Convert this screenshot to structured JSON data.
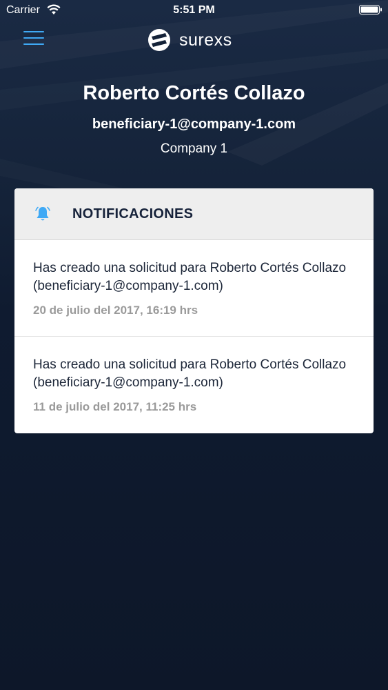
{
  "status_bar": {
    "carrier": "Carrier",
    "time": "5:51 PM"
  },
  "nav": {
    "menu_icon": "hamburger-menu-icon",
    "logo_text": "surexs"
  },
  "profile": {
    "name": "Roberto Cortés Collazo",
    "email": "beneficiary-1@company-1.com",
    "company": "Company 1"
  },
  "notifications": {
    "title": "NOTIFICACIONES",
    "icon": "bell-icon",
    "items": [
      {
        "text": "Has creado una solicitud para Roberto Cortés Collazo (beneficiary-1@company-1.com)",
        "date": "20 de julio del 2017, 16:19 hrs"
      },
      {
        "text": "Has creado una solicitud para Roberto Cortés Collazo (beneficiary-1@company-1.com)",
        "date": "11 de julio del 2017, 11:25 hrs"
      }
    ]
  },
  "colors": {
    "accent": "#3fa9f5",
    "background": "#0e1a2f",
    "card_header": "#eeeeee",
    "date_text": "#9a9a9a"
  }
}
